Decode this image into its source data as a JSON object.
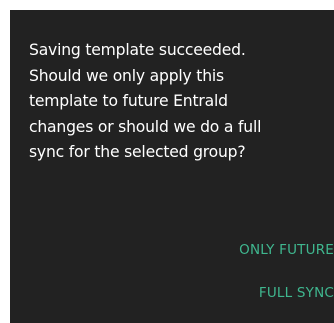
{
  "dialog": {
    "message_lines": [
      "Saving template succeeded.",
      "Should we only apply this",
      "template to future Entrald",
      "changes or should we do a full",
      "sync for the selected group?"
    ],
    "actions": {
      "only_future_label": "ONLY FUTURE",
      "full_sync_label": "FULL SYNC"
    }
  },
  "colors": {
    "dialog_background": "#222222",
    "message_text": "#ffffff",
    "action_text": "#3fb78f",
    "page_background": "#ffffff"
  }
}
